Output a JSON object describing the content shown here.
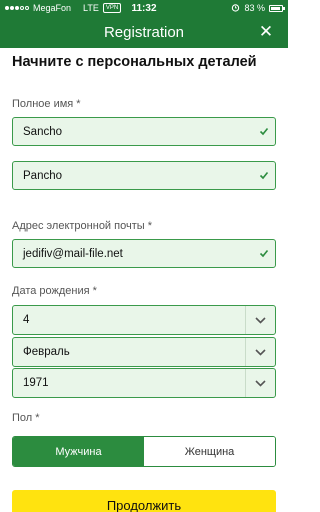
{
  "status_bar": {
    "carrier": "MegaFon",
    "network": "LTE",
    "vpn": "VPN",
    "time": "11:32",
    "battery": "83 %"
  },
  "header": {
    "title": "Registration",
    "close_icon": "close-icon"
  },
  "form": {
    "title": "Начните с персональных деталей",
    "full_name_label": "Полное имя *",
    "first_name": "Sancho",
    "last_name": "Pancho",
    "email_label": "Адрес электронной почты *",
    "email": "jedifiv@mail-file.net",
    "dob_label": "Дата рождения *",
    "dob_day": "4",
    "dob_month": "Февраль",
    "dob_year": "1971",
    "gender_label": "Пол *",
    "gender_options": [
      "Мужчина",
      "Женщина"
    ],
    "continue_label": "Продолжить"
  },
  "colors": {
    "header_bg": "#1f7a36",
    "input_bg": "#e9f6e9",
    "input_border": "#3a9a4a",
    "selected_gender_bg": "#2c8c3f",
    "continue_bg": "#ffe30f"
  }
}
